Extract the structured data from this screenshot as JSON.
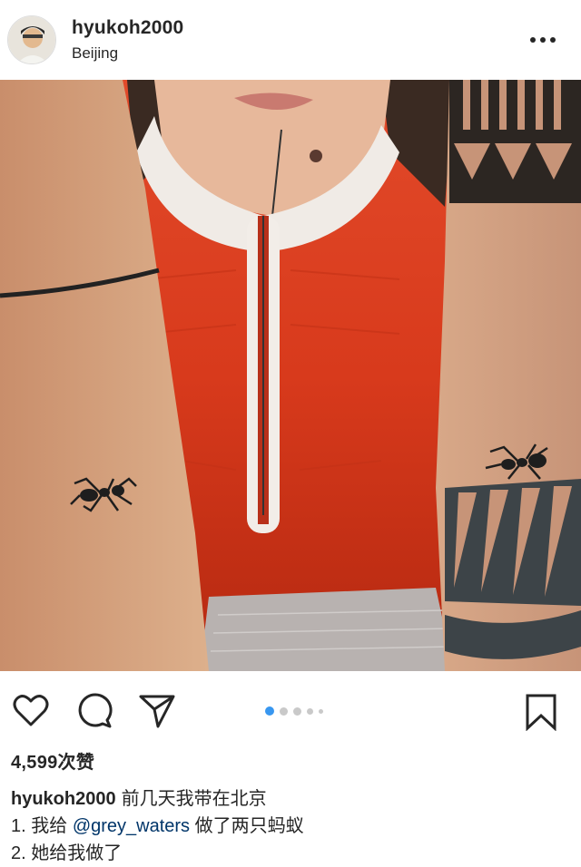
{
  "post": {
    "username": "hyukoh2000",
    "location": "Beijing"
  },
  "icons": {
    "avatar": "user-avatar",
    "more": "more-options-icon",
    "like": "heart-icon",
    "comment": "comment-bubble-icon",
    "share": "send-paper-plane-icon",
    "save": "bookmark-icon"
  },
  "carousel": {
    "total": 5,
    "active_index": 0
  },
  "likes_text": "4,599次赞",
  "caption": {
    "username": "hyukoh2000",
    "line1": "前几天我带在北京",
    "line2_prefix": "1. 我给",
    "line2_mention": "@grey_waters",
    "line2_suffix": "做了两只蚂蚁",
    "line3": "2. 她给我做了"
  },
  "colors": {
    "accent": "#3897f0",
    "text": "#262626",
    "mention": "#003569"
  }
}
